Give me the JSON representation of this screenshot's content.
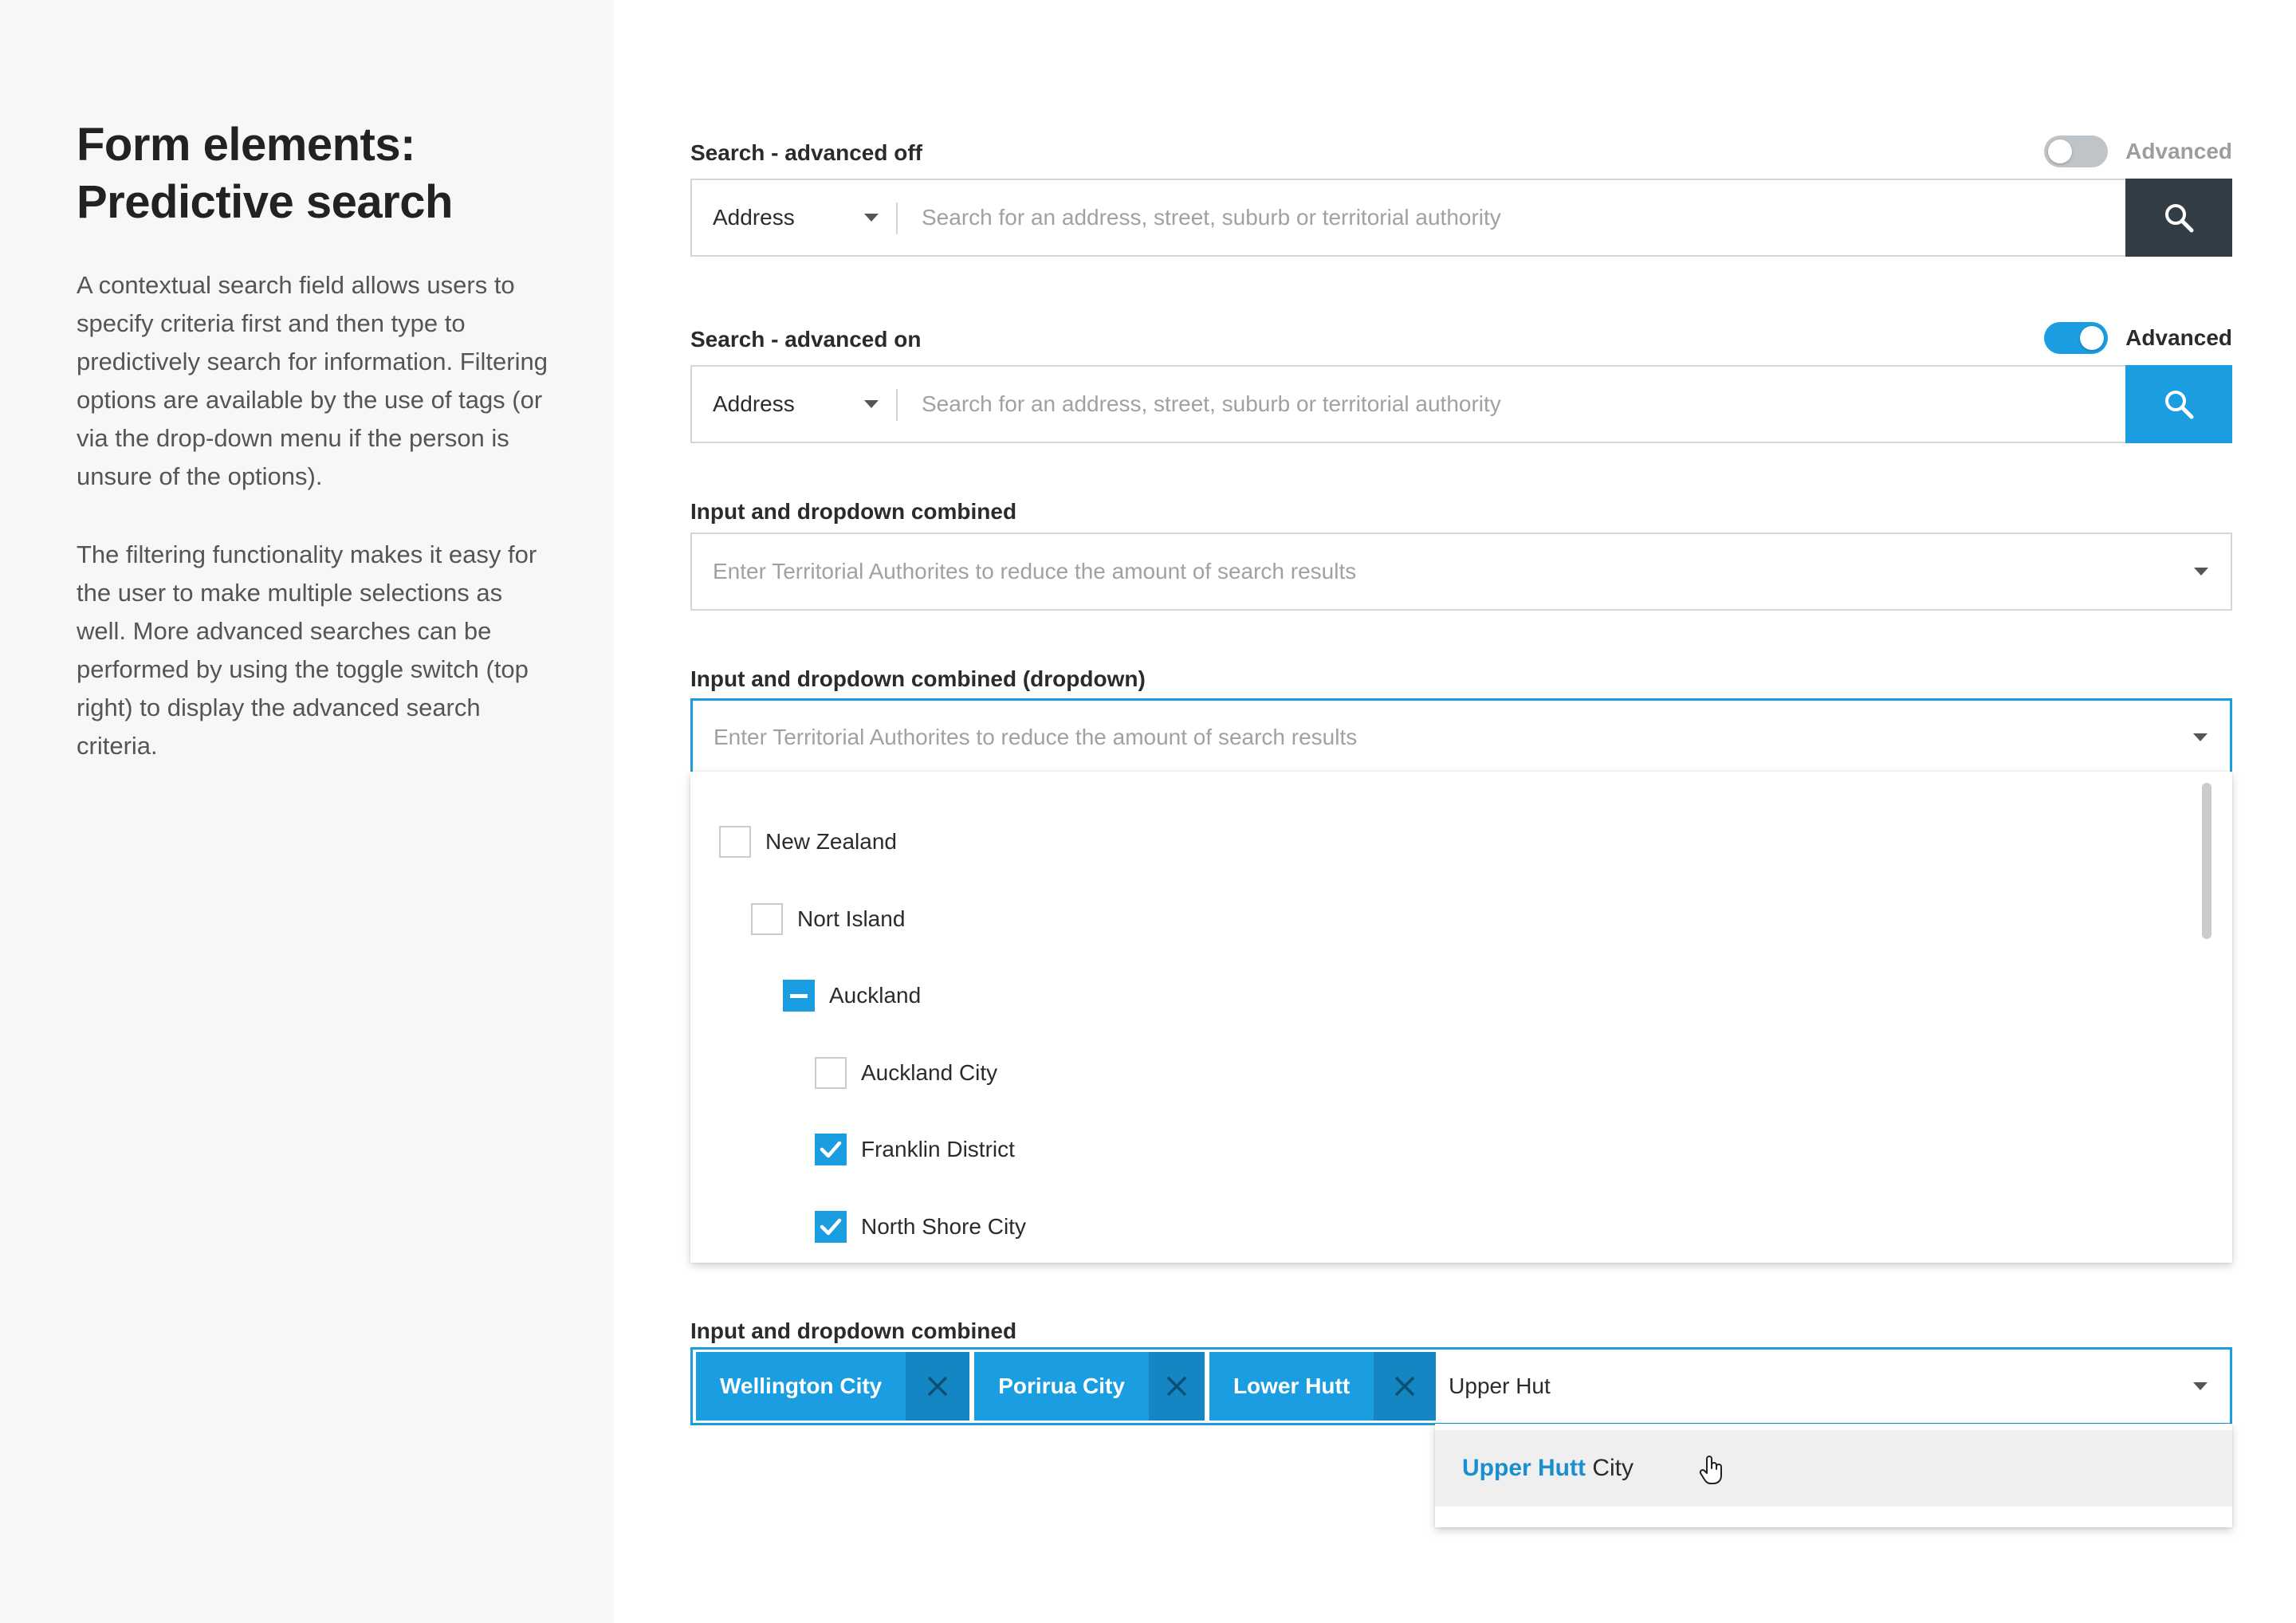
{
  "sidebar": {
    "title": "Form elements: Predictive search",
    "paragraph1": "A contextual search field allows users to specify criteria first and then type to predictively search for information. Filtering options are available by the use of tags (or via the drop-down menu if the person is unsure of the options).",
    "paragraph2": "The filtering functionality makes it easy for the user to make multiple selections as well. More advanced searches can be performed by using the toggle switch (top right) to display the advanced search criteria."
  },
  "search_off": {
    "label": "Search - advanced off",
    "toggle_label": "Advanced",
    "toggle_state": "off",
    "select_value": "Address",
    "placeholder": "Search for an address, street, suburb or territorial authority"
  },
  "search_on": {
    "label": "Search - advanced on",
    "toggle_label": "Advanced",
    "toggle_state": "on",
    "select_value": "Address",
    "placeholder": "Search for an address, street, suburb or territorial authority"
  },
  "combo1": {
    "label": "Input and dropdown combined",
    "placeholder": "Enter Territorial Authorites to reduce the amount of search results"
  },
  "combo2": {
    "label": "Input and dropdown combined (dropdown)",
    "placeholder": "Enter Territorial Authorites to reduce the amount of search results",
    "tree": [
      {
        "label": "New Zealand",
        "state": "unchecked",
        "level": 0
      },
      {
        "label": "Nort Island",
        "state": "unchecked",
        "level": 1
      },
      {
        "label": "Auckland",
        "state": "partial",
        "level": 2
      },
      {
        "label": "Auckland City",
        "state": "unchecked",
        "level": 3
      },
      {
        "label": "Franklin District",
        "state": "checked",
        "level": 3
      },
      {
        "label": "North Shore City",
        "state": "checked",
        "level": 3
      }
    ]
  },
  "combo3": {
    "label": "Input and dropdown combined",
    "tags": [
      "Wellington City",
      "Porirua City",
      "Lower Hutt"
    ],
    "input_value": "Upper Hut",
    "suggestion": {
      "match": "Upper Hutt",
      "rest": " City"
    }
  },
  "colors": {
    "accent": "#1a9ee1",
    "dark_button": "#333d45",
    "sidebar_bg": "#f7f7f7"
  },
  "icons": {
    "search": "search-icon",
    "remove": "close-icon",
    "caret": "chevron-down-icon",
    "cursor": "hand-pointer-icon"
  }
}
